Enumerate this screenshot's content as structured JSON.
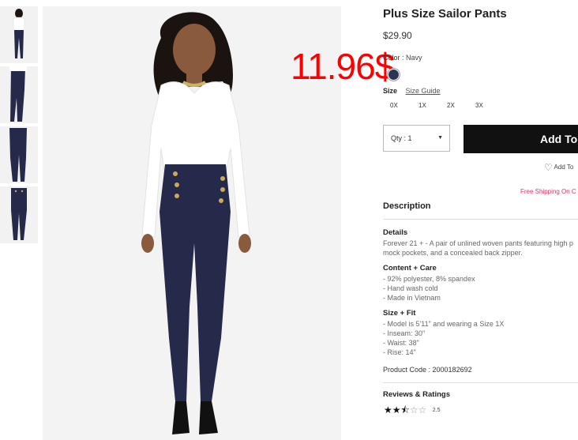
{
  "product": {
    "title": "Plus Size Sailor Pants",
    "price": "$29.90",
    "overlay_price": "11.96$"
  },
  "color": {
    "label": "Color",
    "value": "Navy",
    "swatch_color": "#2c3553"
  },
  "size": {
    "label": "Size",
    "guide_label": "Size Guide",
    "options": [
      "0X",
      "1X",
      "2X",
      "3X"
    ]
  },
  "quantity": {
    "label": "Qty : 1"
  },
  "actions": {
    "add_label": "Add To",
    "wishlist_label": "Add To",
    "free_shipping": "Free Shipping On C"
  },
  "description": {
    "heading": "Description",
    "details_heading": "Details",
    "details_lines": [
      "Forever 21 + - A pair of unlined woven pants featuring high p",
      "mock pockets, and a concealed back zipper."
    ],
    "content_heading": "Content + Care",
    "content_lines": [
      "- 92% polyester, 8% spandex",
      "- Hand wash cold",
      "- Made in Vietnam"
    ],
    "fit_heading": "Size + Fit",
    "fit_lines": [
      "- Model is 5'11\" and wearing a Size 1X",
      "- Inseam: 30\"",
      "- Waist: 38\"",
      "- Rise: 14\""
    ],
    "product_code": "Product Code : 2000182692"
  },
  "reviews": {
    "heading": "Reviews & Ratings",
    "rating": 2.5,
    "rating_label": "2.5"
  },
  "colors": {
    "navy": "#2c3553",
    "shipping_text": "#e0306b",
    "overlay_red": "#ff0000",
    "button_bg": "#111111"
  }
}
